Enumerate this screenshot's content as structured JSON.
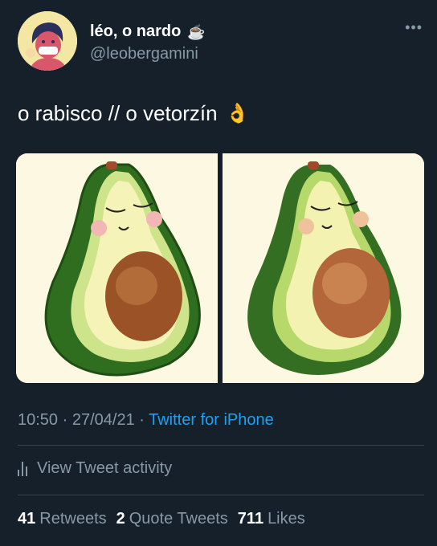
{
  "author": {
    "display_name": "léo, o nardo",
    "emoji": "☕",
    "handle": "@leobergamini",
    "avatar_icon": "avatar-illustration"
  },
  "more_icon": "more-dots-icon",
  "tweet": {
    "text": "o rabisco // o vetorzín",
    "emoji": "👌"
  },
  "media": {
    "left_image": "avocado-sketch",
    "right_image": "avocado-vector"
  },
  "meta": {
    "time": "10:50",
    "sep1": " · ",
    "date": "27/04/21",
    "sep2": " · ",
    "source": "Twitter for iPhone"
  },
  "activity": {
    "label": "View Tweet activity",
    "icon": "analytics-bars-icon"
  },
  "stats": {
    "retweets_count": "41",
    "retweets_label": "Retweets",
    "quotes_count": "2",
    "quotes_label": "Quote Tweets",
    "likes_count": "711",
    "likes_label": "Likes"
  },
  "colors": {
    "background": "#15202b",
    "text_primary": "#ffffff",
    "text_secondary": "#8899a6",
    "link": "#1da1f2",
    "divider": "#38444d"
  }
}
